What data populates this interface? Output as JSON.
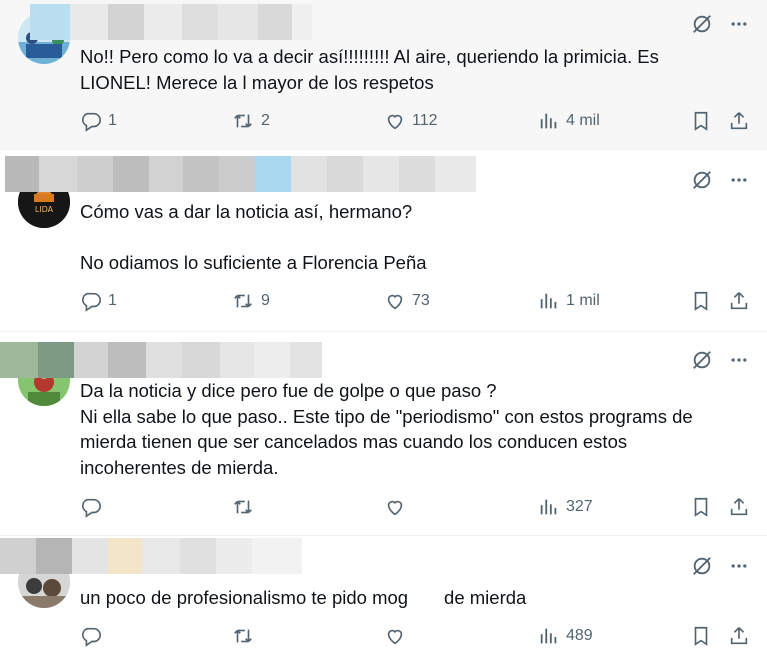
{
  "replies": [
    {
      "text": "No!! Pero como lo va a decir así!!!!!!!!! Al aire, queriendo la primicia. Es LIONEL! Merece la l mayor de los respetos",
      "stats": {
        "replies": "1",
        "reposts": "2",
        "likes": "112",
        "views": "4 mil"
      }
    },
    {
      "text": "Cómo vas a dar la noticia así, hermano?\n\nNo odiamos lo suficiente a Florencia Peña",
      "avatar_label": "LIDA",
      "stats": {
        "replies": "1",
        "reposts": "9",
        "likes": "73",
        "views": "1 mil"
      }
    },
    {
      "text": "Da la noticia y dice pero fue de golpe o que paso ?\nNi ella sabe lo que paso.. Este tipo de \"periodismo\" con estos programs de mierda tienen que ser cancelados mas cuando los conducen estos incoherentes de mierda.",
      "stats": {
        "replies": "",
        "reposts": "",
        "likes": "",
        "views": "327"
      }
    },
    {
      "text": "un poco de profesionalismo te pido mog       de mierda",
      "stats": {
        "replies": "",
        "reposts": "",
        "likes": "",
        "views": "489"
      }
    }
  ],
  "colors": {
    "icon": "#536471",
    "text": "#0f1419",
    "divider": "#eff3f4"
  },
  "icons": [
    "grok-icon",
    "more-icon",
    "reply-icon",
    "repost-icon",
    "like-icon",
    "views-icon",
    "bookmark-icon",
    "share-icon"
  ]
}
